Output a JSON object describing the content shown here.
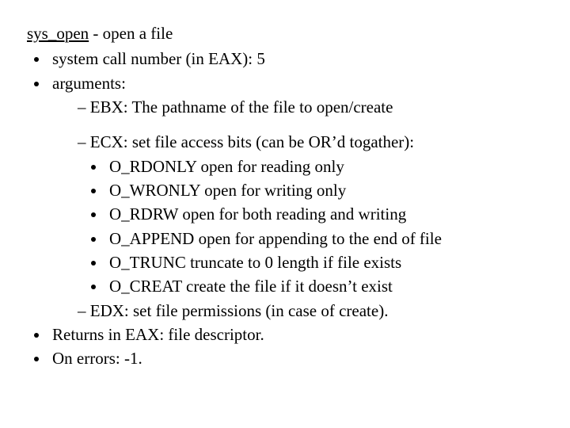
{
  "title_name": "sys_open",
  "title_desc": " - open a file",
  "b1": "system call number (in EAX): 5",
  "b2": "arguments:",
  "b2a": "EBX: The pathname of the file to open/create",
  "b2b": "ECX: set file access bits (can be OR’d togather):",
  "flags": [
    "O_RDONLY open for reading only",
    "O_WRONLY open for writing only",
    "O_RDRW open for both reading and writing",
    "O_APPEND open for appending to the end of file",
    "O_TRUNC truncate to 0 length if file exists",
    "O_CREAT create the file if it doesn’t exist"
  ],
  "b2c": "EDX: set file permissions (in case of create).",
  "b3": "Returns in EAX: file descriptor.",
  "b4": "On errors: -1."
}
